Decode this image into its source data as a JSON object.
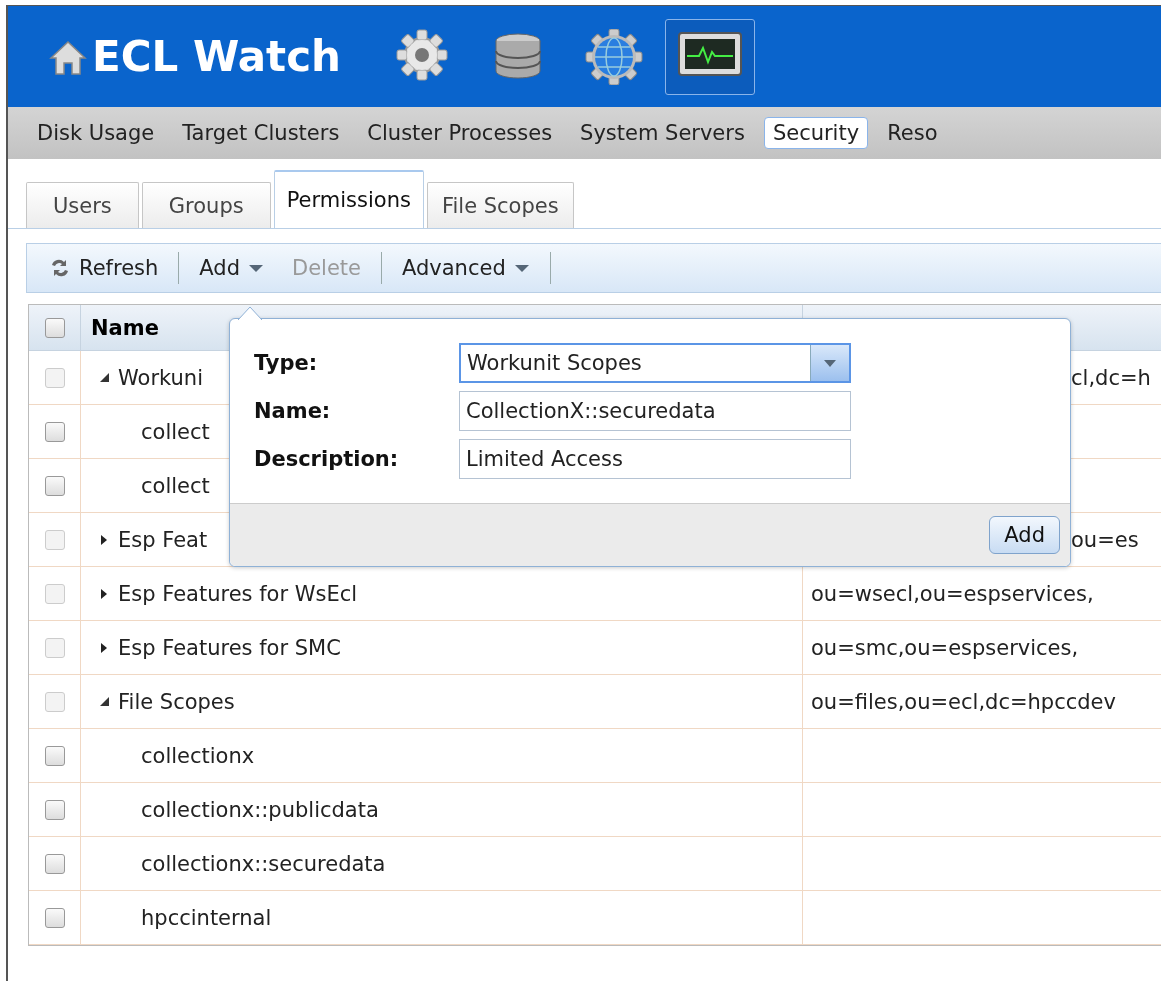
{
  "header": {
    "title": "ECL Watch",
    "icons": [
      {
        "kind": "gear",
        "selected": false
      },
      {
        "kind": "database",
        "selected": false
      },
      {
        "kind": "globe",
        "selected": false
      },
      {
        "kind": "monitor",
        "selected": true
      }
    ]
  },
  "nav": [
    {
      "label": "Disk Usage",
      "selected": false
    },
    {
      "label": "Target Clusters",
      "selected": false
    },
    {
      "label": "Cluster Processes",
      "selected": false
    },
    {
      "label": "System Servers",
      "selected": false
    },
    {
      "label": "Security",
      "selected": true
    },
    {
      "label": "Reso",
      "selected": false
    }
  ],
  "tabs": [
    {
      "label": "Users",
      "selected": false
    },
    {
      "label": "Groups",
      "selected": false
    },
    {
      "label": "Permissions",
      "selected": true
    },
    {
      "label": "File Scopes",
      "selected": false
    }
  ],
  "toolbar": [
    {
      "kind": "refresh",
      "label": "Refresh",
      "disabled": false
    },
    {
      "kind": "separator"
    },
    {
      "kind": "menu",
      "label": "Add",
      "disabled": false
    },
    {
      "kind": "button",
      "label": "Delete",
      "disabled": true
    },
    {
      "kind": "separator"
    },
    {
      "kind": "menu",
      "label": "Advanced",
      "disabled": false
    },
    {
      "kind": "separator"
    }
  ],
  "table": {
    "columns": [
      "Name"
    ],
    "select_all_checked": false,
    "rows": [
      {
        "name": "Workuni",
        "column_2": "cl,dc=h",
        "expanded": true,
        "disabled": true,
        "children": [
          {
            "name": "collect",
            "disabled": false
          },
          {
            "name": "collect",
            "disabled": false
          }
        ]
      },
      {
        "name": "Esp Feat",
        "column_2": "ou=es",
        "expanded": false,
        "disabled": true
      },
      {
        "name": "Esp Features for WsEcl",
        "column_2": "ou=wsecl,ou=espservices,",
        "expanded": false,
        "disabled": true
      },
      {
        "name": "Esp Features for SMC",
        "column_2": "ou=smc,ou=espservices,",
        "expanded": false,
        "disabled": true
      },
      {
        "name": "File Scopes",
        "column_2": "ou=files,ou=ecl,dc=hpccdev",
        "expanded": true,
        "disabled": true,
        "children": [
          {
            "name": "collectionx",
            "disabled": false
          },
          {
            "name": "collectionx::publicdata",
            "disabled": false
          },
          {
            "name": "collectionx::securedata",
            "disabled": false
          },
          {
            "name": "hpccinternal",
            "disabled": false
          }
        ]
      }
    ]
  },
  "dialog": {
    "fields": [
      {
        "kind": "select",
        "label": "Type:",
        "value": "Workunit Scopes"
      },
      {
        "kind": "text",
        "label": "Name:",
        "value": "CollectionX::securedata"
      },
      {
        "kind": "text",
        "label": "Description:",
        "value": "Limited Access"
      }
    ],
    "button": "Add"
  }
}
